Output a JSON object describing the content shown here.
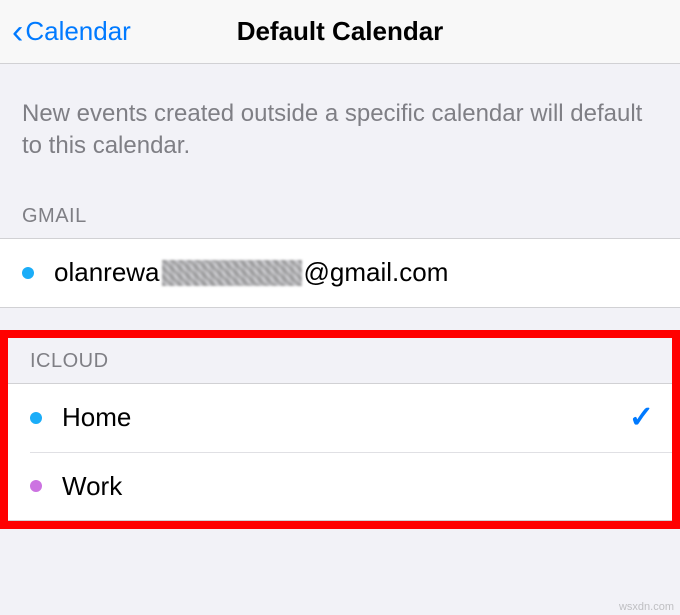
{
  "nav": {
    "back_label": "Calendar",
    "title": "Default Calendar"
  },
  "description": "New events created outside a specific calendar will default to this calendar.",
  "sections": {
    "gmail": {
      "header": "GMAIL",
      "items": [
        {
          "label_prefix": "olanrewa",
          "label_suffix": "@gmail.com",
          "color": "blue",
          "selected": false
        }
      ]
    },
    "icloud": {
      "header": "ICLOUD",
      "items": [
        {
          "label": "Home",
          "color": "blue",
          "selected": true
        },
        {
          "label": "Work",
          "color": "purple",
          "selected": false
        }
      ]
    }
  },
  "watermark": "wsxdn.com"
}
